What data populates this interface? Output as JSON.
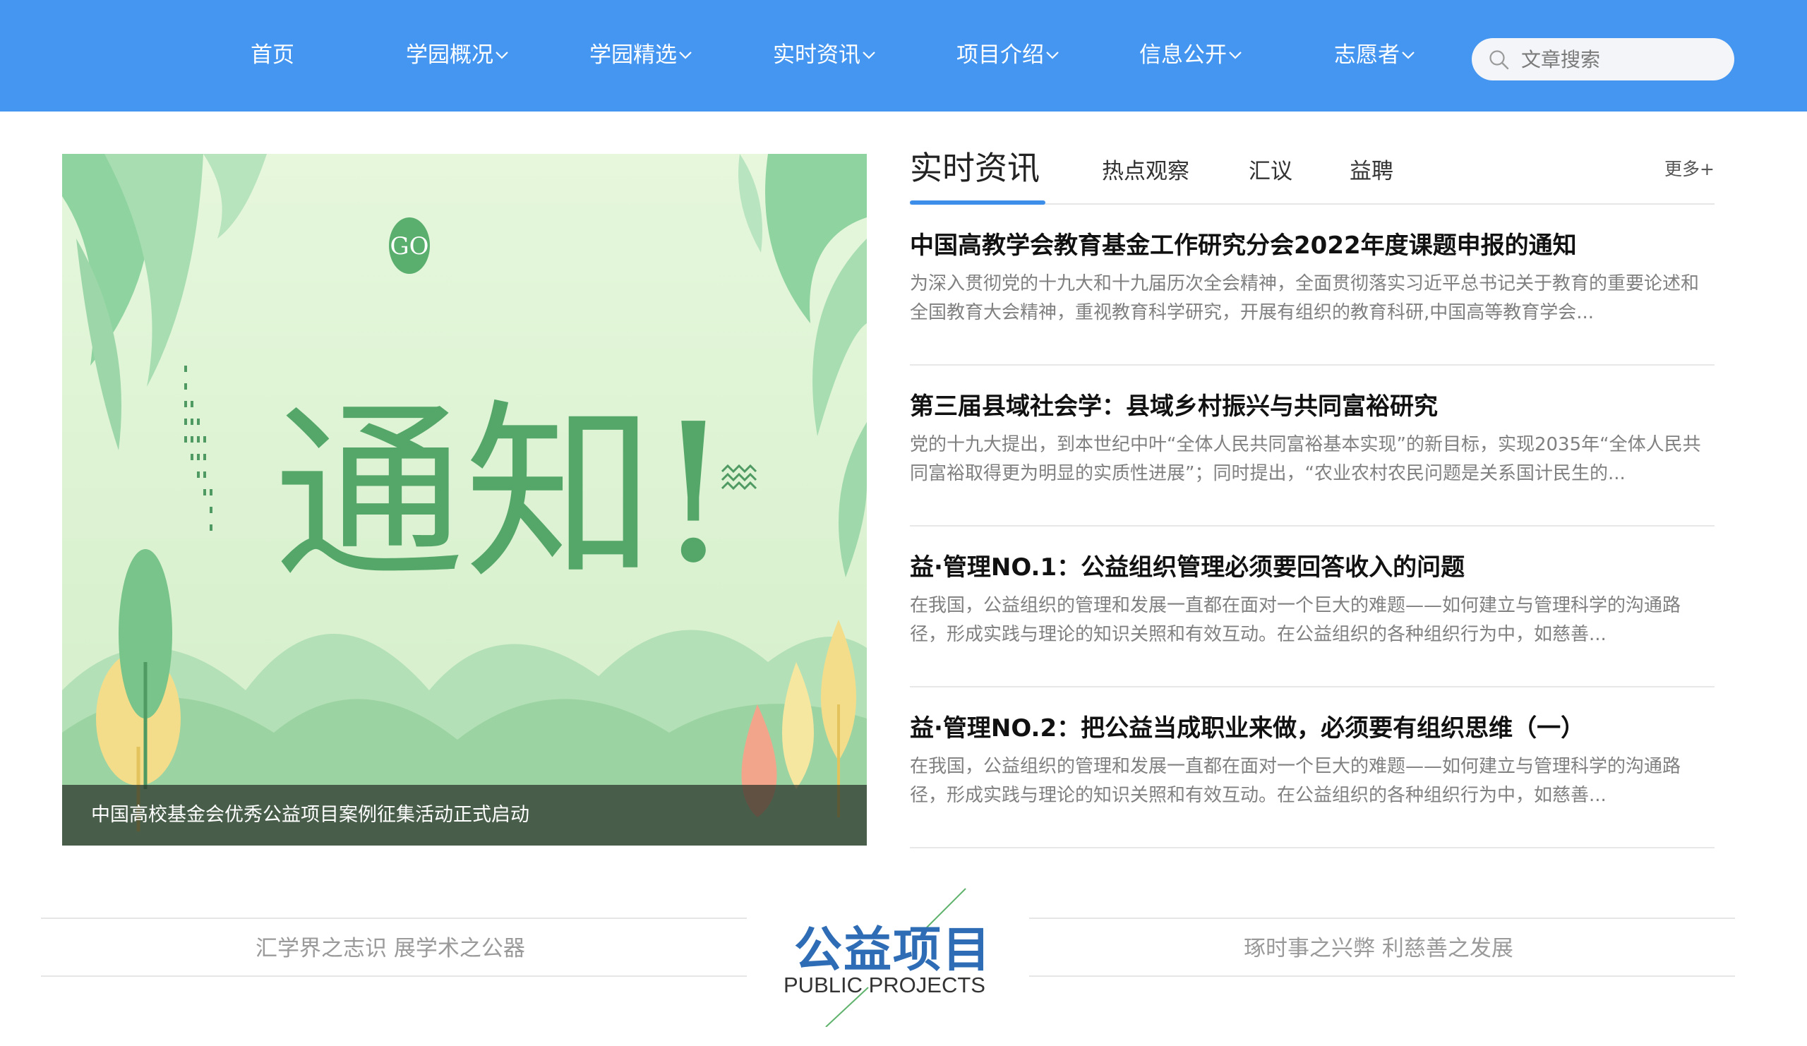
{
  "nav": {
    "items": [
      {
        "label": "首页",
        "has_dropdown": false
      },
      {
        "label": "学园概况",
        "has_dropdown": true
      },
      {
        "label": "学园精选",
        "has_dropdown": true
      },
      {
        "label": "实时资讯",
        "has_dropdown": true
      },
      {
        "label": "项目介绍",
        "has_dropdown": true
      },
      {
        "label": "信息公开",
        "has_dropdown": true
      },
      {
        "label": "志愿者",
        "has_dropdown": true
      }
    ],
    "search": {
      "placeholder": "文章搜索",
      "value": "",
      "icon": "search-icon"
    }
  },
  "banner": {
    "image_text": "通知!",
    "badge_text": "GO",
    "caption": "中国高校基金会优秀公益项目案例征集活动正式启动"
  },
  "news": {
    "tabs": [
      {
        "label": "实时资讯",
        "active": true
      },
      {
        "label": "热点观察",
        "active": false
      },
      {
        "label": "汇议",
        "active": false
      },
      {
        "label": "益聘",
        "active": false
      }
    ],
    "more_label": "更多+",
    "items": [
      {
        "title": "中国高教学会教育基金工作研究分会2022年度课题申报的通知",
        "summary": "为深入贯彻党的十九大和十九届历次全会精神，全面贯彻落实习近平总书记关于教育的重要论述和全国教育大会精神，重视教育科学研究，开展有组织的教育科研,中国高等教育学会..."
      },
      {
        "title": "第三届县域社会学：县域乡村振兴与共同富裕研究",
        "summary": "党的十九大提出，到本世纪中叶“全体人民共同富裕基本实现”的新目标，实现2035年“全体人民共同富裕取得更为明显的实质性进展”；同时提出，“农业农村农民问题是关系国计民生的..."
      },
      {
        "title": "益·管理NO.1：公益组织管理必须要回答收入的问题",
        "summary": "在我国，公益组织的管理和发展一直都在面对一个巨大的难题——如何建立与管理科学的沟通路径，形成实践与理论的知识关照和有效互动。在公益组织的各种组织行为中，如慈善..."
      },
      {
        "title": "益·管理NO.2：把公益当成职业来做，必须要有组织思维（一）",
        "summary": "在我国，公益组织的管理和发展一直都在面对一个巨大的难题——如何建立与管理科学的沟通路径，形成实践与理论的知识关照和有效互动。在公益组织的各种组织行为中，如慈善..."
      }
    ]
  },
  "section": {
    "title": "公益项目",
    "subtitle": "PUBLIC PROJECTS",
    "left_slogan": "汇学界之志识 展学术之公器",
    "right_slogan": "琢时事之兴弊 利慈善之发展"
  },
  "colors": {
    "nav_bg": "#4596f0",
    "accent": "#3d8ee8",
    "section_title": "#2e6db5",
    "banner_green": "#6cbb7d"
  }
}
